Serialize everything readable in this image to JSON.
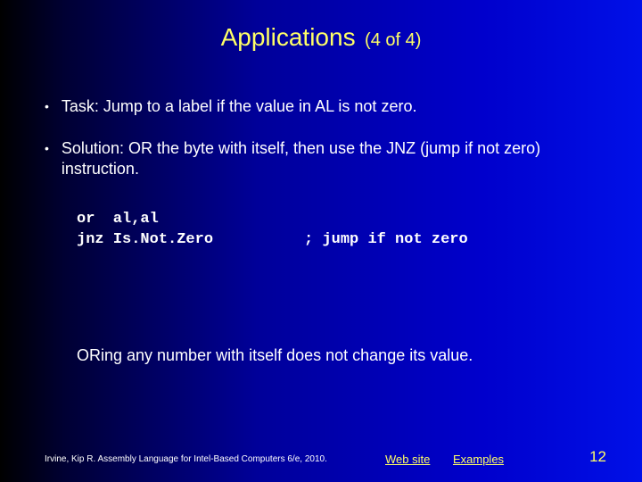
{
  "title": {
    "main": "Applications",
    "sub": "(4 of 4)"
  },
  "bullets": [
    "Task: Jump to a label if the value in AL is not zero.",
    "Solution: OR the byte with itself, then use the JNZ (jump if not zero) instruction."
  ],
  "code": "or  al,al\njnz Is.Not.Zero          ; jump if not zero",
  "note": "ORing any number with itself does not change its value.",
  "footer": {
    "citation": "Irvine, Kip R. Assembly Language for Intel-Based Computers 6/e, 2010.",
    "links": {
      "website": "Web site",
      "examples": "Examples"
    },
    "page": "12"
  }
}
